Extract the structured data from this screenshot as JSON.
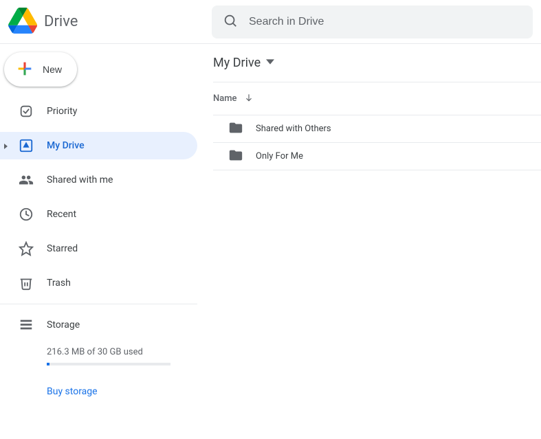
{
  "header": {
    "product": "Drive",
    "search_placeholder": "Search in Drive"
  },
  "new_button_label": "New",
  "sidebar": {
    "items": [
      {
        "label": "Priority"
      },
      {
        "label": "My Drive"
      },
      {
        "label": "Shared with me"
      },
      {
        "label": "Recent"
      },
      {
        "label": "Starred"
      },
      {
        "label": "Trash"
      }
    ],
    "storage_label": "Storage",
    "storage_text": "216.3 MB of 30 GB used",
    "buy_label": "Buy storage"
  },
  "main": {
    "breadcrumb": "My Drive",
    "column_name": "Name",
    "rows": [
      {
        "name": "Shared with Others"
      },
      {
        "name": "Only For Me"
      }
    ]
  }
}
